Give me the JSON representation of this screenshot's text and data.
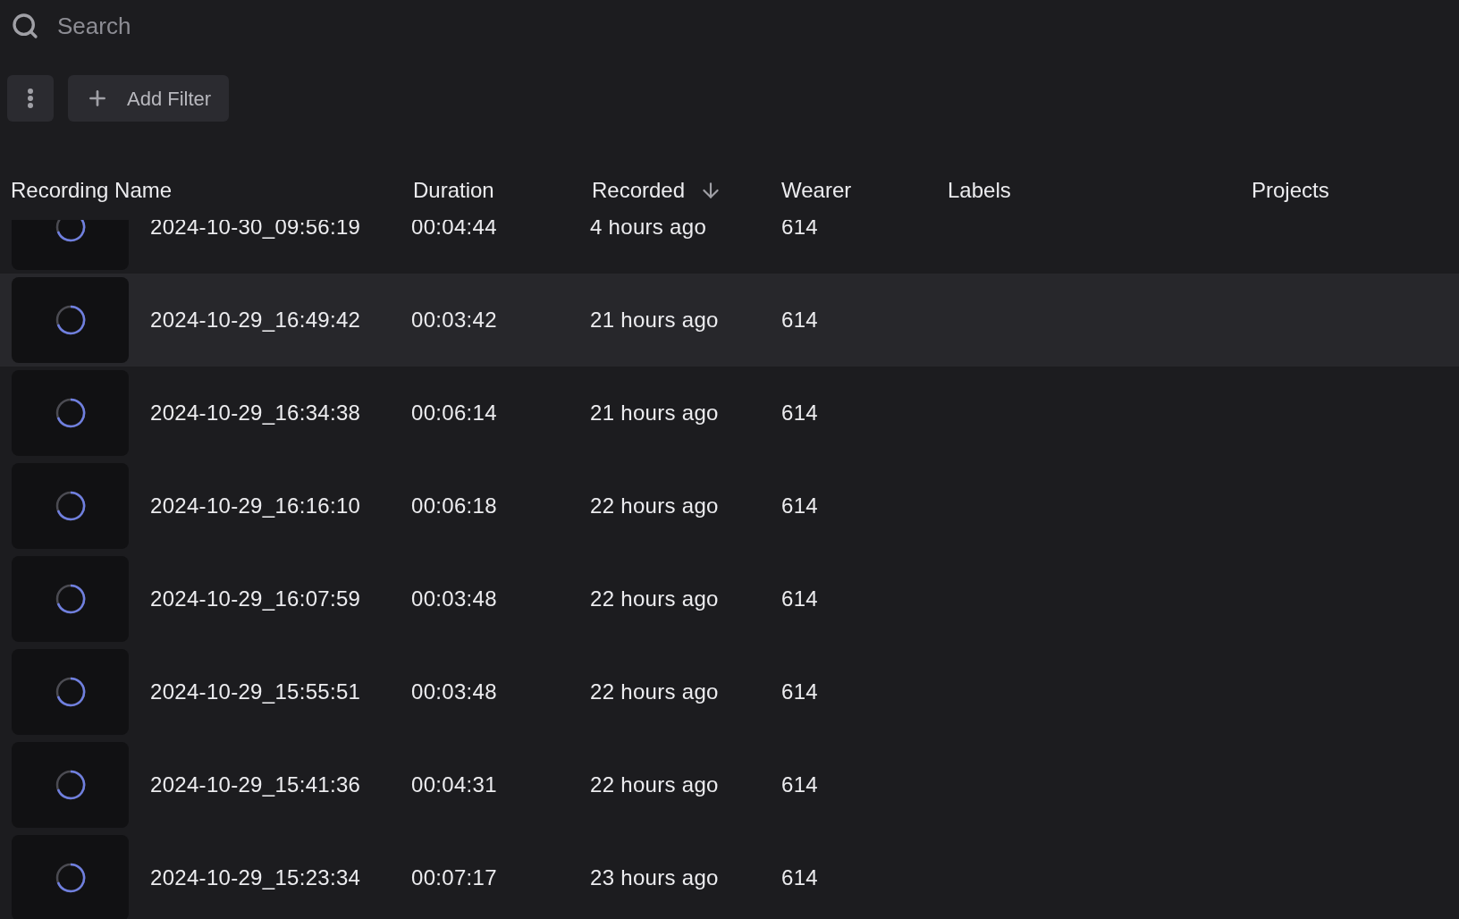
{
  "search": {
    "placeholder": "Search"
  },
  "toolbar": {
    "add_filter": "Add Filter"
  },
  "table": {
    "columns": [
      {
        "label": "Recording Name",
        "sorted": false
      },
      {
        "label": "Duration",
        "sorted": false
      },
      {
        "label": "Recorded",
        "sorted": true
      },
      {
        "label": "Wearer",
        "sorted": false
      },
      {
        "label": "Labels",
        "sorted": false
      },
      {
        "label": "Projects",
        "sorted": false
      }
    ],
    "rows": [
      {
        "name": "2024-10-30_09:56:19",
        "duration": "00:04:44",
        "recorded": "4 hours ago",
        "wearer": "614",
        "selected": false
      },
      {
        "name": "2024-10-29_16:49:42",
        "duration": "00:03:42",
        "recorded": "21 hours ago",
        "wearer": "614",
        "selected": true
      },
      {
        "name": "2024-10-29_16:34:38",
        "duration": "00:06:14",
        "recorded": "21 hours ago",
        "wearer": "614",
        "selected": false
      },
      {
        "name": "2024-10-29_16:16:10",
        "duration": "00:06:18",
        "recorded": "22 hours ago",
        "wearer": "614",
        "selected": false
      },
      {
        "name": "2024-10-29_16:07:59",
        "duration": "00:03:48",
        "recorded": "22 hours ago",
        "wearer": "614",
        "selected": false
      },
      {
        "name": "2024-10-29_15:55:51",
        "duration": "00:03:48",
        "recorded": "22 hours ago",
        "wearer": "614",
        "selected": false
      },
      {
        "name": "2024-10-29_15:41:36",
        "duration": "00:04:31",
        "recorded": "22 hours ago",
        "wearer": "614",
        "selected": false
      },
      {
        "name": "2024-10-29_15:23:34",
        "duration": "00:07:17",
        "recorded": "23 hours ago",
        "wearer": "614",
        "selected": false
      }
    ]
  }
}
